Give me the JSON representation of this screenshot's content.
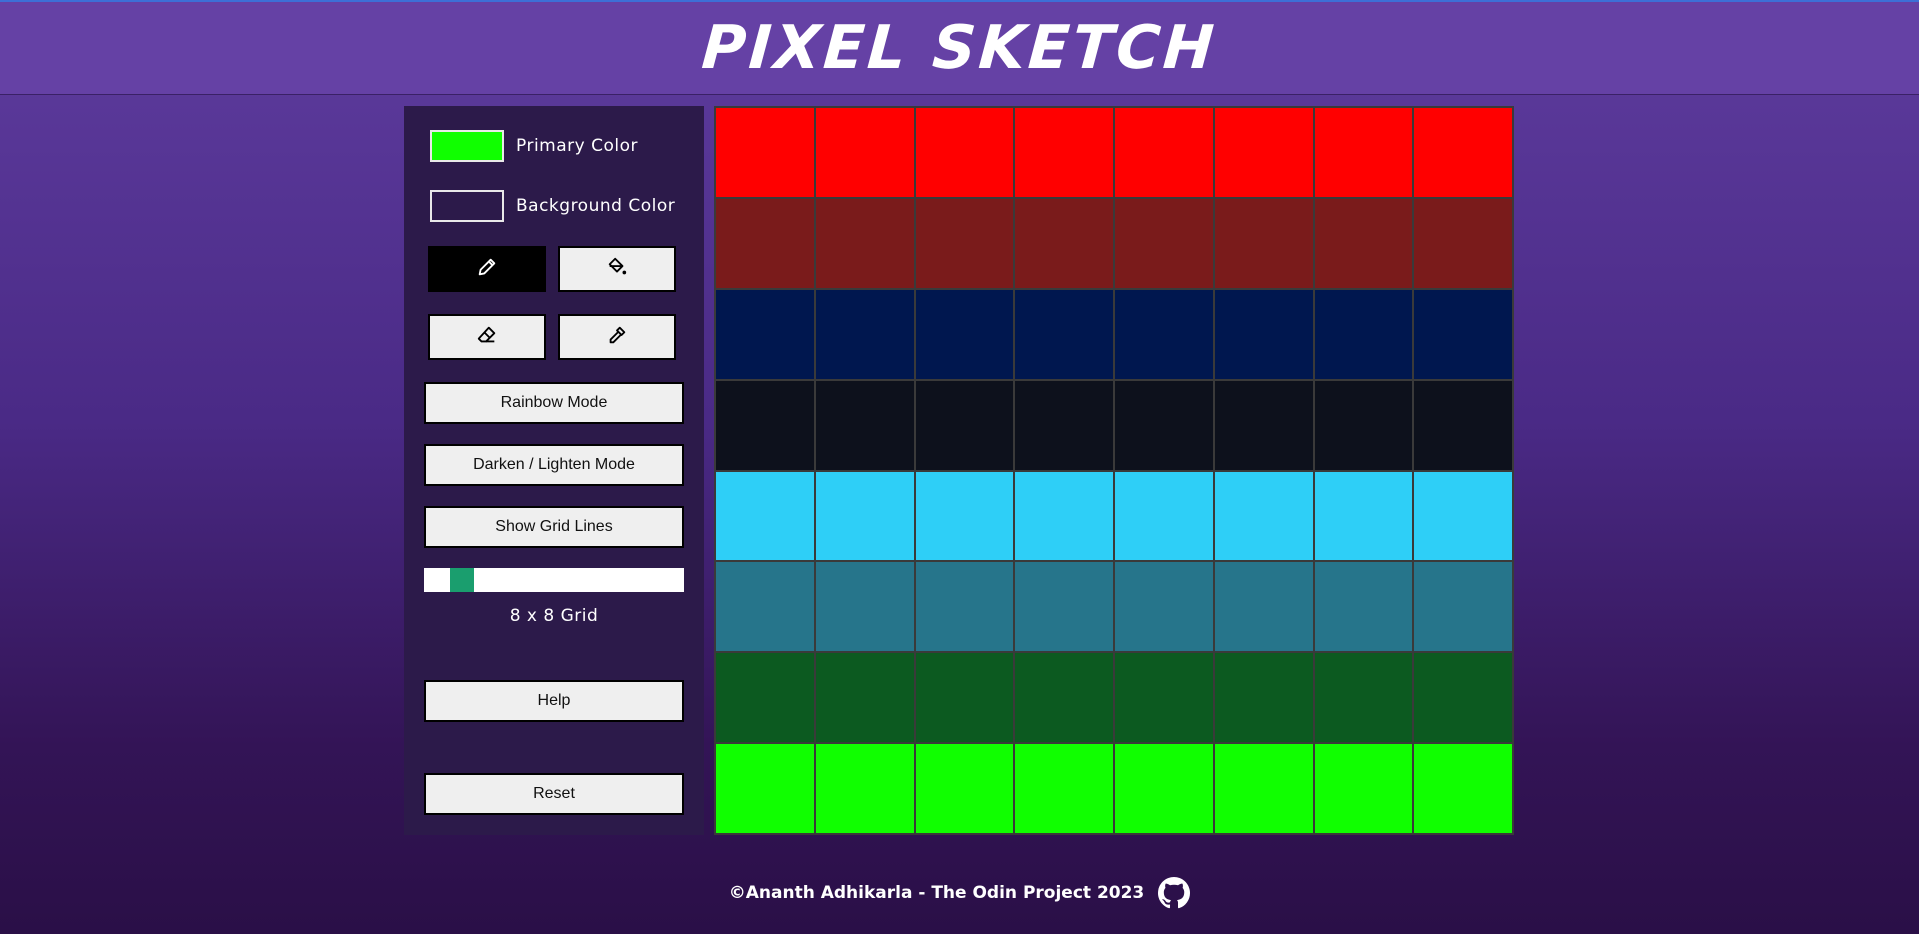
{
  "header": {
    "title": "PIXEL SKETCH"
  },
  "controls": {
    "primary_color": {
      "label": "Primary Color",
      "value": "#10ff00"
    },
    "background_color": {
      "label": "Background Color",
      "value": "#2c1a4a"
    },
    "tools": [
      {
        "name": "pencil",
        "icon": "pencil-icon",
        "active": true
      },
      {
        "name": "fill",
        "icon": "paint-bucket-icon",
        "active": false
      },
      {
        "name": "eraser",
        "icon": "eraser-icon",
        "active": false
      },
      {
        "name": "eyedropper",
        "icon": "eyedropper-icon",
        "active": false
      }
    ],
    "rainbow_label": "Rainbow Mode",
    "shade_label": "Darken / Lighten Mode",
    "gridlines_label": "Show Grid Lines",
    "grid_size": 8,
    "grid_size_text": "8 x 8 Grid",
    "help_label": "Help",
    "reset_label": "Reset"
  },
  "canvas": {
    "rows": 8,
    "cols": 8,
    "row_colors": [
      "#ff0000",
      "#7a1b1b",
      "#00174f",
      "#0d111c",
      "#2ecff7",
      "#26758b",
      "#0c5a20",
      "#10ff00"
    ]
  },
  "footer": {
    "text": "©Ananth Adhikarla - The Odin Project 2023",
    "icon": "github-icon"
  }
}
